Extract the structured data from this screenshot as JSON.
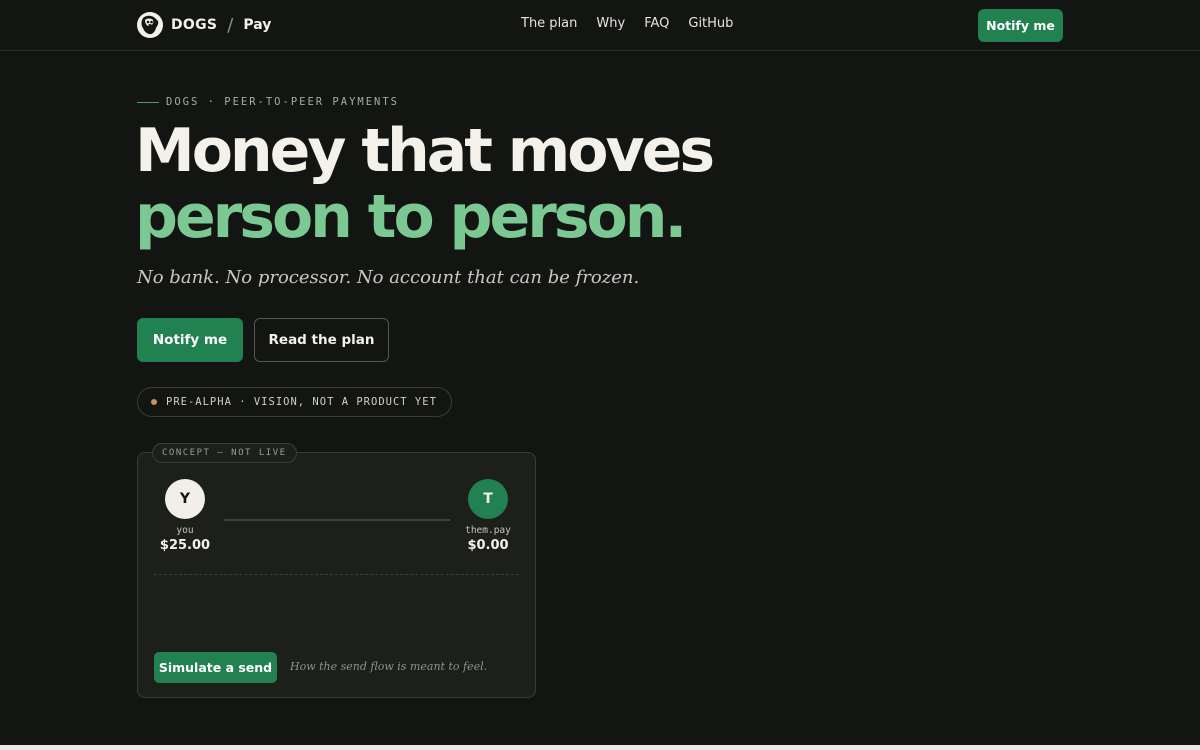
{
  "nav": {
    "brand": "DOGS",
    "separator": "/",
    "product": "Pay",
    "links": [
      "The plan",
      "Why",
      "FAQ",
      "GitHub"
    ],
    "cta": "Notify me"
  },
  "hero": {
    "eyebrow": "DOGS · PEER-TO-PEER PAYMENTS",
    "headline_line1": "Money that moves",
    "headline_line2": "person to person.",
    "subtitle": "No bank. No processor. No account that can be frozen.",
    "primary_button": "Notify me",
    "secondary_button": "Read the plan",
    "status": "PRE-ALPHA · VISION, NOT A PRODUCT YET"
  },
  "demo": {
    "tag": "CONCEPT — NOT LIVE",
    "sender": {
      "initial": "Y",
      "label": "you",
      "amount": "$25.00"
    },
    "receiver": {
      "initial": "T",
      "label": "them.pay",
      "amount": "$0.00"
    },
    "button": "Simulate a send",
    "note": "How the send flow is meant to feel."
  },
  "colors": {
    "background": "#131512",
    "accent_green": "#218150",
    "headline_green": "#7cc893",
    "status_dot": "#c8925a"
  },
  "icons": {
    "logo": "dog-head-icon"
  }
}
